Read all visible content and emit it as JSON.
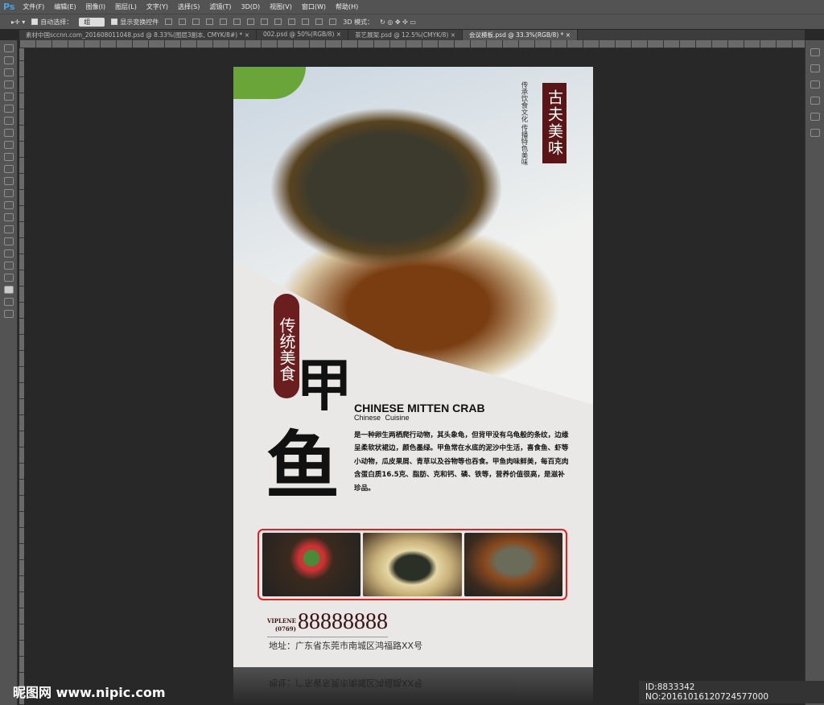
{
  "app": {
    "logo": "Ps",
    "menu": [
      "文件(F)",
      "编辑(E)",
      "图像(I)",
      "图层(L)",
      "文字(Y)",
      "选择(S)",
      "滤镜(T)",
      "3D(D)",
      "视图(V)",
      "窗口(W)",
      "帮助(H)"
    ]
  },
  "options": {
    "auto_select_label": "自动选择：",
    "auto_select_value": "组",
    "show_transform_label": "显示变换控件",
    "mode_3d_label": "3D 模式："
  },
  "tabs": [
    {
      "label": "素材中国sccnn.com_201608011048.psd @ 8.33%(图层3副本, CMYK/8#) *"
    },
    {
      "label": "002.psd @ 50%(RGB/8)"
    },
    {
      "label": "茶艺展架.psd @ 12.5%(CMYK/8)"
    },
    {
      "label": "会议模板.psd @ 33.3%(RGB/8) *"
    }
  ],
  "poster": {
    "tag": "古夫美味",
    "tag_sub": "传承饮食文化 传播特色美味",
    "badge": "传统美食",
    "title_1": "甲",
    "title_2": "鱼",
    "en_title": "CHINESE MITTEN CRAB",
    "en_sub": "Chinese Cuisine",
    "description": "是一种卵生两栖爬行动物，其头象龟，但背甲没有乌龟般的条纹，边缘呈柔软状裙边，颜色墨绿。甲鱼常在水底的泥沙中生活，喜食鱼、虾等小动物，瓜皮果屑、青草以及谷物等也吞食。甲鱼肉味鲜美，每百克肉含蛋白质16.5克、脂肪、克和钙、磷、铁等，营养价值很高，是滋补珍品。",
    "vip_label": "VIPLENE",
    "area_code": "(0769)",
    "phone": "88888888",
    "address": "地址：广东省东莞市南城区鸿福路XX号"
  },
  "watermark": "昵图网 www.nipic.com",
  "image_id": "ID:8833342 NO:20161016120724577000"
}
